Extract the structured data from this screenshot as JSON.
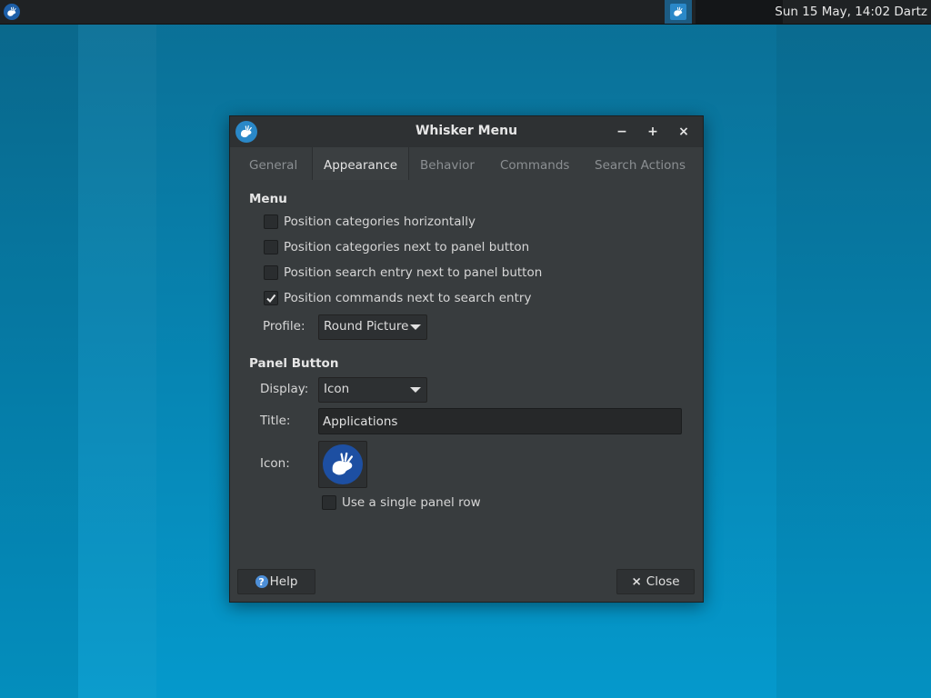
{
  "taskbar": {
    "menu_icon": "xfce-mouse-icon",
    "task_icon": "whisker-menu-icon",
    "clock": "Sun 15 May, 14:02 Dartz"
  },
  "window": {
    "title": "Whisker Menu",
    "controls": {
      "minimize": "−",
      "maximize": "+",
      "close": "×"
    },
    "tabs": [
      "General",
      "Appearance",
      "Behavior",
      "Commands",
      "Search Actions"
    ],
    "active_tab": "Appearance"
  },
  "menu_section": {
    "heading": "Menu",
    "options": [
      {
        "label": "Position categories horizontally",
        "checked": false
      },
      {
        "label": "Position categories next to panel button",
        "checked": false
      },
      {
        "label": "Position search entry next to panel button",
        "checked": false
      },
      {
        "label": "Position commands next to search entry",
        "checked": true
      }
    ],
    "profile_label": "Profile:",
    "profile_value": "Round Picture"
  },
  "panel_button_section": {
    "heading": "Panel Button",
    "display_label": "Display:",
    "display_value": "Icon",
    "title_label": "Title:",
    "title_value": "Applications",
    "icon_label": "Icon:",
    "icon_name": "xfce-mouse-icon",
    "single_row_label": "Use a single panel row",
    "single_row_checked": false
  },
  "footer": {
    "help_label": "Help",
    "close_label": "Close"
  },
  "colors": {
    "window_bg": "#383c3e",
    "titlebar_bg": "#2e3133",
    "accent": "#2a88c8",
    "desktop": "#0686b4"
  }
}
